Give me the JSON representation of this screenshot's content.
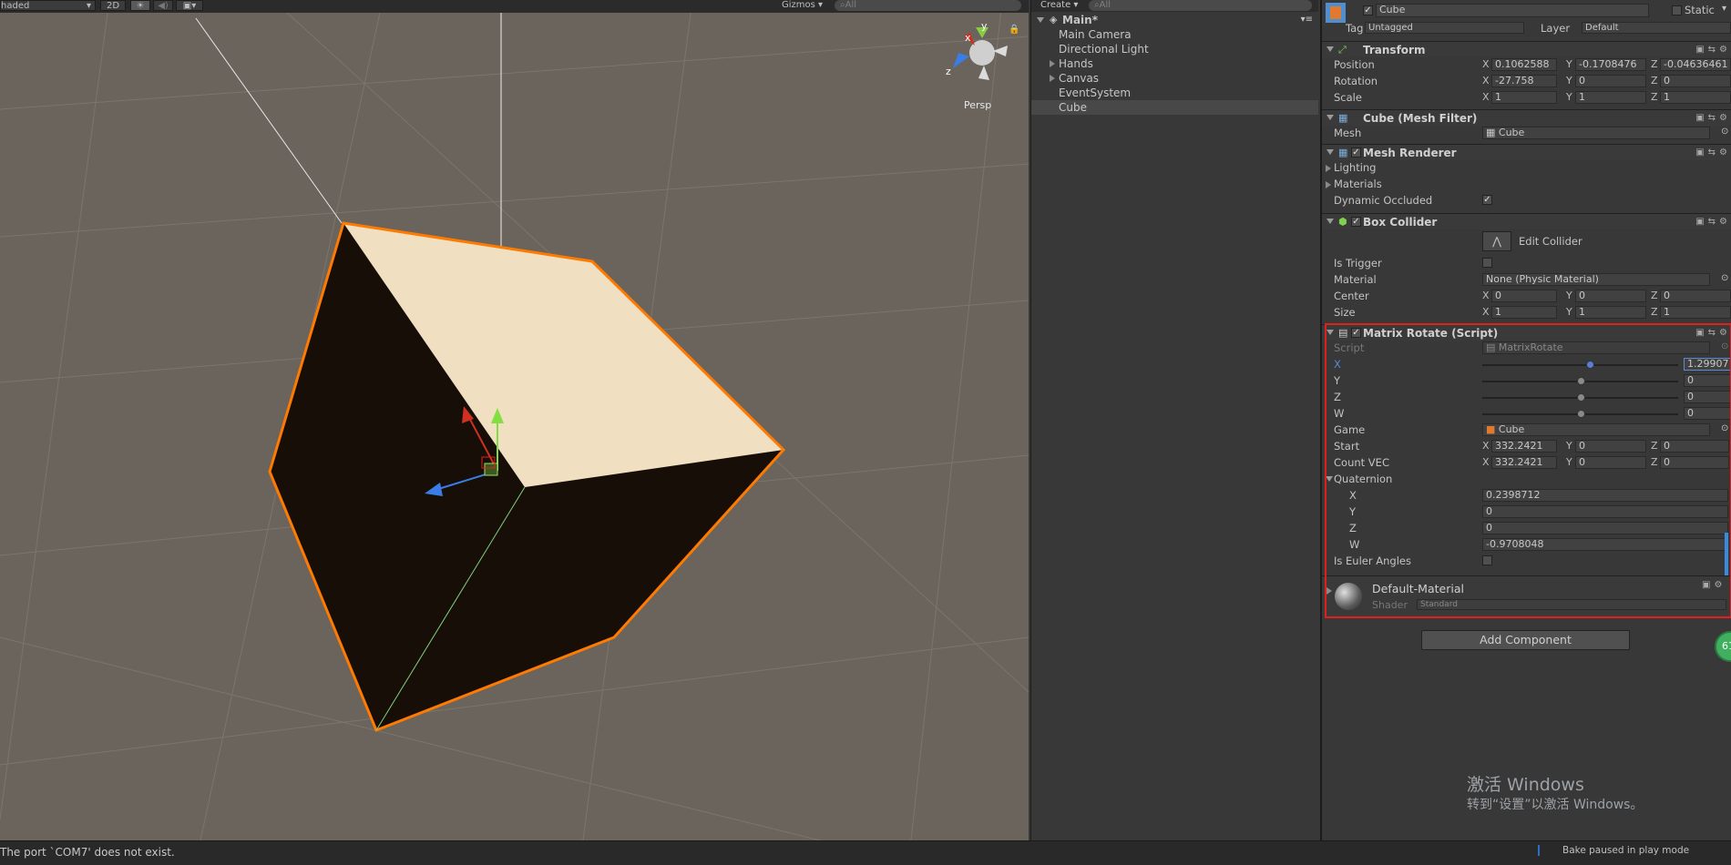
{
  "scene_toolbar": {
    "shading": "haded",
    "mode_2d": "2D",
    "gizmos": "Gizmos",
    "search_placeholder": "All"
  },
  "scene": {
    "persp_label": "Persp",
    "gizmo_y": "y",
    "gizmo_x": "x",
    "gizmo_z": "z"
  },
  "hierarchy": {
    "create_label": "Create",
    "search_placeholder": "All",
    "scene_name": "Main*",
    "items": [
      {
        "label": "Main Camera"
      },
      {
        "label": "Directional Light"
      },
      {
        "label": "Hands"
      },
      {
        "label": "Canvas"
      },
      {
        "label": "EventSystem"
      },
      {
        "label": "Cube"
      }
    ]
  },
  "inspector": {
    "object_name": "Cube",
    "static_label": "Static",
    "tag_label": "Tag",
    "tag_value": "Untagged",
    "layer_label": "Layer",
    "layer_value": "Default",
    "transform": {
      "title": "Transform",
      "position_label": "Position",
      "position": {
        "x": "0.1062588",
        "y": "-0.1708476",
        "z": "-0.04636461"
      },
      "rotation_label": "Rotation",
      "rotation": {
        "x": "-27.758",
        "y": "0",
        "z": "0"
      },
      "scale_label": "Scale",
      "scale": {
        "x": "1",
        "y": "1",
        "z": "1"
      }
    },
    "mesh_filter": {
      "title": "Cube (Mesh Filter)",
      "mesh_label": "Mesh",
      "mesh_value": "Cube"
    },
    "mesh_renderer": {
      "title": "Mesh Renderer",
      "lighting": "Lighting",
      "materials": "Materials",
      "dynamic_occluded": "Dynamic Occluded"
    },
    "box_collider": {
      "title": "Box Collider",
      "edit_collider": "Edit Collider",
      "is_trigger": "Is Trigger",
      "material_label": "Material",
      "material_value": "None (Physic Material)",
      "center_label": "Center",
      "center": {
        "x": "0",
        "y": "0",
        "z": "0"
      },
      "size_label": "Size",
      "size": {
        "x": "1",
        "y": "1",
        "z": "1"
      }
    },
    "matrix_rotate": {
      "title": "Matrix Rotate (Script)",
      "script_label": "Script",
      "script_value": "MatrixRotate",
      "x_label": "X",
      "x_value": "1.29907",
      "x_slider": 0.55,
      "y_label": "Y",
      "y_value": "0",
      "y_slider": 0.5,
      "z_label": "Z",
      "z_value": "0",
      "z_slider": 0.5,
      "w_label": "W",
      "w_value": "0",
      "w_slider": 0.5,
      "game_label": "Game",
      "game_value": "Cube",
      "start_label": "Start",
      "start": {
        "x": "332.2421",
        "y": "0",
        "z": "0"
      },
      "count_label": "Count VEC",
      "count": {
        "x": "332.2421",
        "y": "0",
        "z": "0"
      },
      "quaternion_label": "Quaternion",
      "quaternion": [
        {
          "label": "X",
          "value": "0.2398712"
        },
        {
          "label": "Y",
          "value": "0"
        },
        {
          "label": "Z",
          "value": "0"
        },
        {
          "label": "W",
          "value": "-0.9708048"
        }
      ],
      "euler_label": "Is Euler Angles"
    },
    "material": {
      "name": "Default-Material",
      "shader_label": "Shader",
      "shader_value": "Standard"
    },
    "add_component": "Add Component",
    "badge": "61"
  },
  "status": {
    "message": "The port `COM7' does not exist.",
    "bake": "Bake paused in play mode"
  },
  "watermark": {
    "line1": "激活 Windows",
    "line2": "转到“设置”以激活 Windows。"
  },
  "colors": {
    "selection_outline": "#ff7a00",
    "highlight_box": "#e0201e",
    "scene_bg": "#6a645c"
  }
}
